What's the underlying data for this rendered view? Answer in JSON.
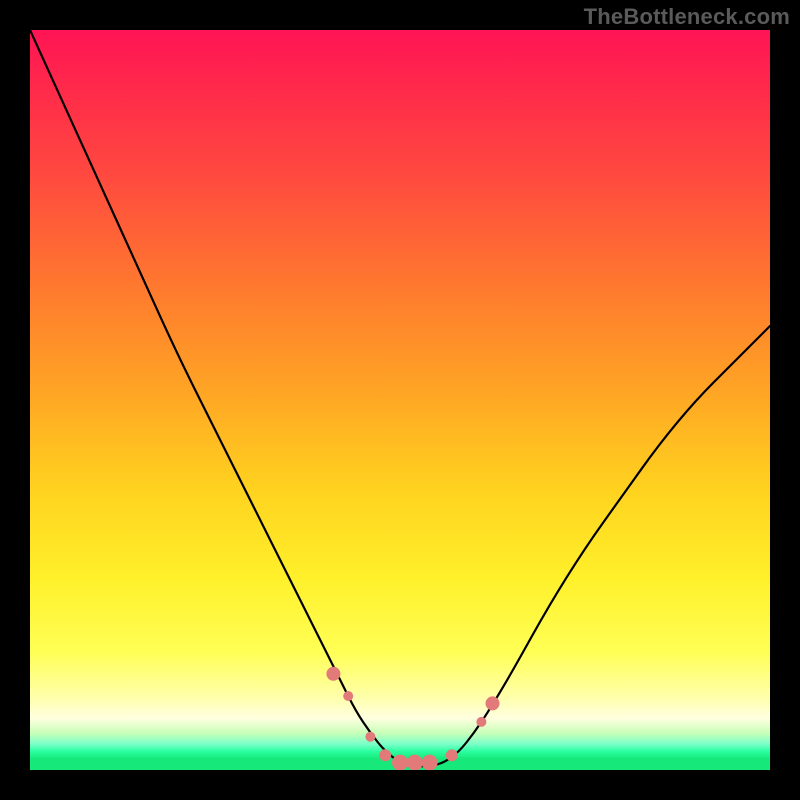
{
  "watermark": "TheBottleneck.com",
  "chart_data": {
    "type": "line",
    "title": "",
    "xlabel": "",
    "ylabel": "",
    "xlim": [
      0,
      100
    ],
    "ylim": [
      0,
      100
    ],
    "grid": false,
    "series": [
      {
        "name": "bottleneck-curve",
        "x": [
          0,
          5,
          10,
          15,
          20,
          25,
          30,
          35,
          38,
          40,
          42,
          44,
          46,
          48,
          50,
          52,
          54,
          56,
          58,
          60,
          62,
          65,
          70,
          75,
          80,
          85,
          90,
          95,
          100
        ],
        "values": [
          100,
          89,
          78,
          67,
          56,
          46,
          36,
          26,
          20,
          16,
          12,
          8,
          5,
          2.5,
          1,
          0.5,
          0.5,
          1,
          2.5,
          5,
          8,
          13,
          22,
          30,
          37,
          44,
          50,
          55,
          60
        ]
      }
    ],
    "markers": {
      "name": "data-dots",
      "x": [
        41,
        43,
        46,
        48,
        50,
        52,
        54,
        57,
        61,
        62.5
      ],
      "values": [
        13,
        10,
        4.5,
        2,
        1,
        1,
        1,
        2,
        6.5,
        9
      ],
      "size": [
        7,
        5,
        5,
        6,
        8,
        8,
        8,
        6,
        5,
        7
      ]
    },
    "colors": {
      "curve": "#000000",
      "marker": "#e27a7a",
      "gradient_top": "#ff1455",
      "gradient_mid": "#ffd21f",
      "gradient_bottom": "#16e87a"
    }
  }
}
